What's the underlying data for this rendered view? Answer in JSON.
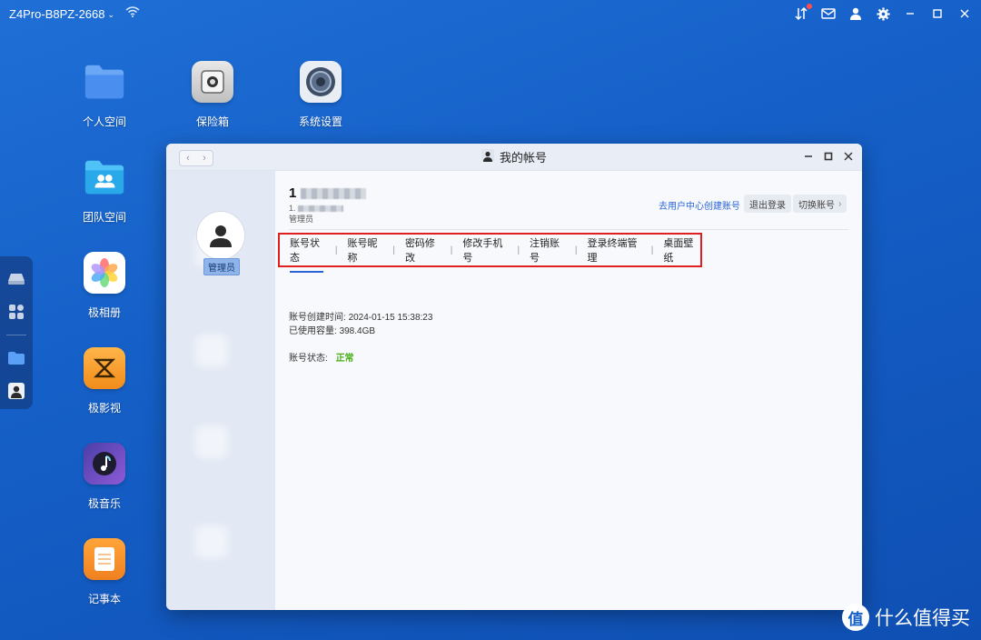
{
  "topbar": {
    "device_name": "Z4Pro-B8PZ-2668",
    "icons": [
      "wifi-icon",
      "transfer-icon",
      "message-icon",
      "user-icon",
      "settings-icon",
      "minimize-icon",
      "maximize-icon",
      "close-icon"
    ]
  },
  "desktop": {
    "apps": [
      {
        "label": "个人空间",
        "icon": "folder-icon"
      },
      {
        "label": "保险箱",
        "icon": "safe-icon"
      },
      {
        "label": "系统设置",
        "icon": "settings-icon"
      },
      {
        "label": "团队空间",
        "icon": "team-folder-icon"
      },
      {
        "label": "极相册",
        "icon": "photos-icon"
      },
      {
        "label": "极影视",
        "icon": "video-icon"
      },
      {
        "label": "极音乐",
        "icon": "music-icon"
      },
      {
        "label": "记事本",
        "icon": "notes-icon"
      }
    ]
  },
  "window": {
    "title": "我的帐号",
    "user": {
      "name_prefix": "1",
      "id_prefix": "1.",
      "role": "管理员",
      "role_tag": "管理员"
    },
    "create_link": "去用户中心创建账号",
    "logout_button": "退出登录",
    "switch_button": "切换账号",
    "tabs": [
      "账号状态",
      "账号昵称",
      "密码修改",
      "修改手机号",
      "注销账号",
      "登录终端管理",
      "桌面壁纸"
    ],
    "active_tab": "账号状态",
    "info": {
      "created_label": "账号创建时间:",
      "created_value": "2024-01-15 15:38:23",
      "used_label": "已使用容量:",
      "used_value": "398.4GB",
      "status_label": "账号状态:",
      "status_value": "正常"
    }
  },
  "watermark": {
    "logo_text": "值",
    "text": "什么值得买"
  },
  "colors": {
    "accent": "#2a63d6",
    "highlight_box": "#e02020",
    "status_ok": "#4caf1a"
  }
}
